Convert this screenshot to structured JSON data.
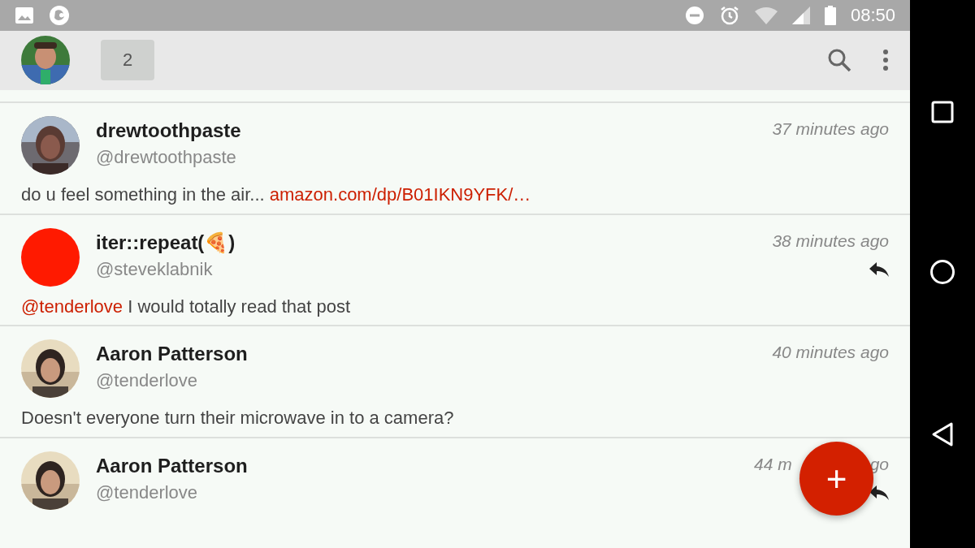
{
  "status_bar": {
    "time": "08:50"
  },
  "toolbar": {
    "count": "2"
  },
  "posts": [
    {
      "name": "drewtoothpaste",
      "handle": "@drewtoothpaste",
      "time": [
        "37 minutes ago"
      ],
      "kind": "picture",
      "replied": false,
      "body": [
        {
          "kind": "plain",
          "text": "do u feel something in the air... "
        },
        {
          "kind": "link",
          "text": "amazon.com/dp/B01IKN9YFK/…"
        }
      ]
    },
    {
      "name": "iter::repeat(🍕)",
      "handle": "@steveklabnik",
      "time": [
        "38 minutes ago"
      ],
      "kind": "dot",
      "color": "#ff1a00",
      "replied": true,
      "body": [
        {
          "kind": "link",
          "text": "@tenderlove"
        },
        {
          "kind": "plain",
          "text": " I would totally read that post"
        }
      ]
    },
    {
      "name": "Aaron Patterson",
      "handle": "@tenderlove",
      "time": [
        "40 minutes ago"
      ],
      "kind": "picture",
      "replied": false,
      "body": [
        {
          "kind": "plain",
          "text": "Doesn't everyone turn their microwave in to a camera?"
        }
      ]
    },
    {
      "name": "Aaron Patterson",
      "handle": "@tenderlove",
      "time": [
        "44 m",
        "go"
      ],
      "kind": "picture",
      "replied": true
    }
  ],
  "fab": {
    "label": "+"
  }
}
